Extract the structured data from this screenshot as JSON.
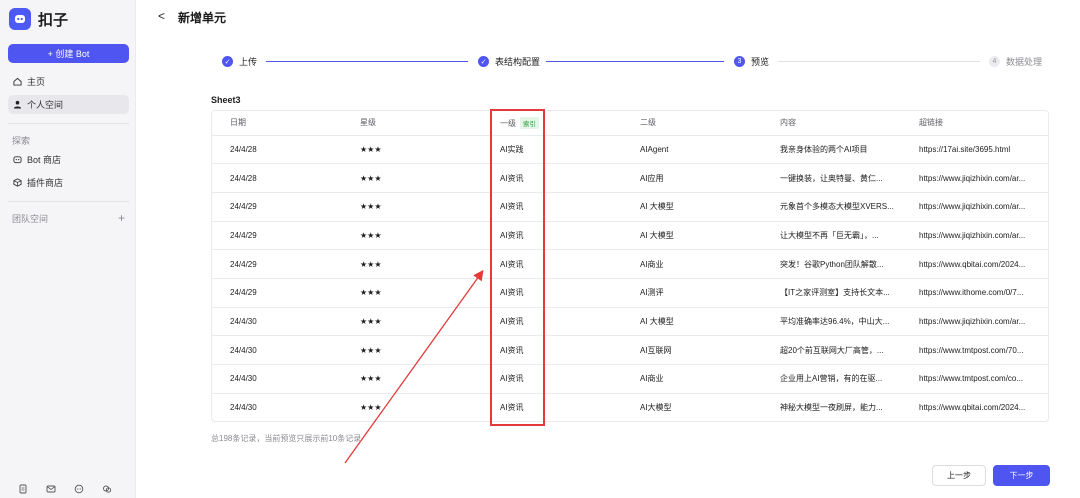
{
  "app": {
    "name": "扣子"
  },
  "sidebar": {
    "create_label": "+ 创建 Bot",
    "items": [
      {
        "label": "主页",
        "icon": "home-icon"
      },
      {
        "label": "个人空间",
        "icon": "user-icon"
      }
    ],
    "explore_title": "探索",
    "explore_items": [
      {
        "label": "Bot 商店",
        "icon": "bot-icon"
      },
      {
        "label": "插件商店",
        "icon": "plugin-icon"
      }
    ],
    "team_title": "团队空间",
    "team_add": "+"
  },
  "header": {
    "back": "<",
    "title": "新增单元"
  },
  "steps": [
    {
      "label": "上传",
      "marker": "✓",
      "state": "done"
    },
    {
      "label": "表结构配置",
      "marker": "✓",
      "state": "done"
    },
    {
      "label": "预览",
      "marker": "3",
      "state": "current"
    },
    {
      "label": "数据处理",
      "marker": "4",
      "state": "pending"
    }
  ],
  "sheet": {
    "name": "Sheet3"
  },
  "table": {
    "columns": [
      "日期",
      "星级",
      "一级",
      "二级",
      "内容",
      "超链接"
    ],
    "index_badge": "索引",
    "rows": [
      [
        "24/4/28",
        "★★★",
        "AI实践",
        "AIAgent",
        "我亲身体验的两个AI项目",
        "https://17ai.site/3695.html"
      ],
      [
        "24/4/28",
        "★★★",
        "AI资讯",
        "AI应用",
        "一键换装，让奥特曼、黄仁...",
        "https://www.jiqizhixin.com/ar..."
      ],
      [
        "24/4/29",
        "★★★",
        "AI资讯",
        "AI 大模型",
        "元象首个多模态大模型XVERS...",
        "https://www.jiqizhixin.com/ar..."
      ],
      [
        "24/4/29",
        "★★★",
        "AI资讯",
        "AI 大模型",
        "让大模型不再「巨无霸」，...",
        "https://www.jiqizhixin.com/ar..."
      ],
      [
        "24/4/29",
        "★★★",
        "AI资讯",
        "AI商业",
        "突发！谷歌Python团队解散...",
        "https://www.qbitai.com/2024..."
      ],
      [
        "24/4/29",
        "★★★",
        "AI资讯",
        "AI测评",
        "【IT之家评测室】支持长文本...",
        "https://www.ithome.com/0/7..."
      ],
      [
        "24/4/30",
        "★★★",
        "AI资讯",
        "AI 大模型",
        "平均准确率达96.4%，中山大...",
        "https://www.jiqizhixin.com/ar..."
      ],
      [
        "24/4/30",
        "★★★",
        "AI资讯",
        "AI互联网",
        "超20个前互联网大厂高管，...",
        "https://www.tmtpost.com/70..."
      ],
      [
        "24/4/30",
        "★★★",
        "AI资讯",
        "AI商业",
        "企业用上AI营销，有的在驱...",
        "https://www.tmtpost.com/co..."
      ],
      [
        "24/4/30",
        "★★★",
        "AI资讯",
        "AI大模型",
        "神秘大模型一夜刷屏，能力...",
        "https://www.qbitai.com/2024..."
      ]
    ]
  },
  "footer": {
    "note": "总198条记录，当前预览只展示前10条记录"
  },
  "buttons": {
    "prev": "上一步",
    "next": "下一步"
  },
  "colors": {
    "accent": "#4e55f0",
    "highlight": "#e53a3a",
    "badge_bg": "#e5f6e6",
    "badge_text": "#2f9a3d"
  }
}
